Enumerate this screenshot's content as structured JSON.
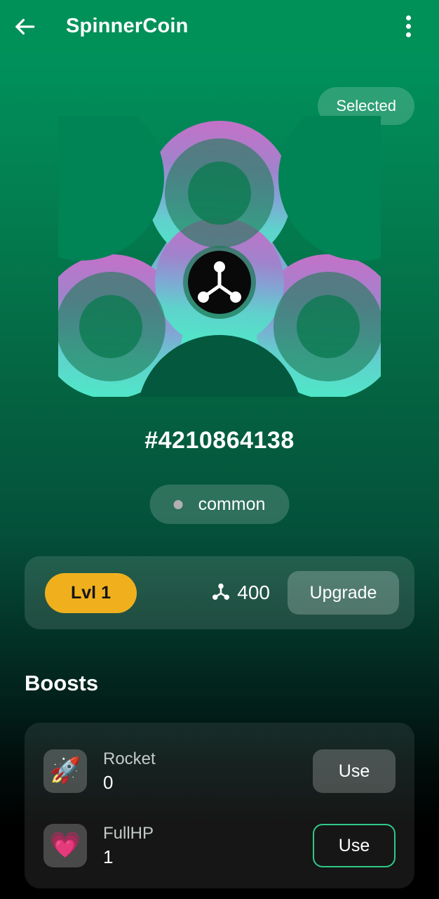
{
  "appbar": {
    "back_icon": "arrow-left-icon",
    "title": "SpinnerCoin",
    "overflow_icon": "more-vertical-icon",
    "background_color": "#009159"
  },
  "status": {
    "selected_label": "Selected"
  },
  "spinner": {
    "hub_icon": "spinner-molecule-icon",
    "gradient_top_color": "#C471C8",
    "gradient_mid_color": "#7FA8D4",
    "gradient_bottom_color": "#4FE8C8",
    "hub_color": "#090909"
  },
  "token": {
    "id": "#4210864138",
    "rarity": "common",
    "rarity_dot_color": "#b0b0b0"
  },
  "level_panel": {
    "level_label": "Lvl 1",
    "level_pill_color": "#F0B01E",
    "cost_icon": "spinner-molecule-icon",
    "cost_value": "400",
    "upgrade_label": "Upgrade"
  },
  "boosts": {
    "section_title": "Boosts",
    "items": [
      {
        "icon": "🚀",
        "icon_name": "rocket-emoji-icon",
        "name": "Rocket",
        "count": "0",
        "button_label": "Use",
        "button_state": "disabled"
      },
      {
        "icon": "💗",
        "icon_name": "pink-heart-emoji-icon",
        "name": "FullHP",
        "count": "1",
        "button_label": "Use",
        "button_state": "enabled"
      }
    ]
  }
}
